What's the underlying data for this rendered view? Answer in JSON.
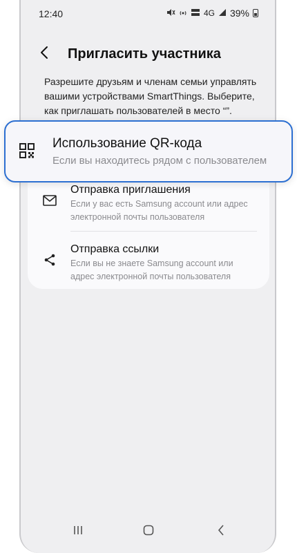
{
  "status_bar": {
    "time": "12:40",
    "network": "4G",
    "battery": "39%",
    "icons": [
      "mute-vibrate-icon",
      "hotspot-icon",
      "volte-icon",
      "signal-icon",
      "battery-icon"
    ]
  },
  "header": {
    "title": "Пригласить участника",
    "back_icon": "chevron-left-icon"
  },
  "description": "Разрешите друзьям и членам семьи управлять вашими устройствами SmartThings. Выберите, как приглашать пользователей в место “”.",
  "highlighted_option": {
    "icon": "qr-code-icon",
    "title": "Использование QR-кода",
    "description": "Если вы находитесь рядом с пользователем"
  },
  "options": [
    {
      "icon": "mail-icon",
      "title": "Отправка приглашения",
      "description": "Если у вас есть Samsung account или адрес электронной почты пользователя"
    },
    {
      "icon": "share-icon",
      "title": "Отправка ссылки",
      "description": "Если вы не знаете Samsung account или адрес электронной почты пользователя"
    }
  ],
  "nav_bar": {
    "icons": [
      "recents-icon",
      "home-icon",
      "back-icon"
    ]
  },
  "colors": {
    "highlight_border": "#2c6fd1",
    "screen_background": "#efeff1",
    "card_background": "#fafafc"
  }
}
